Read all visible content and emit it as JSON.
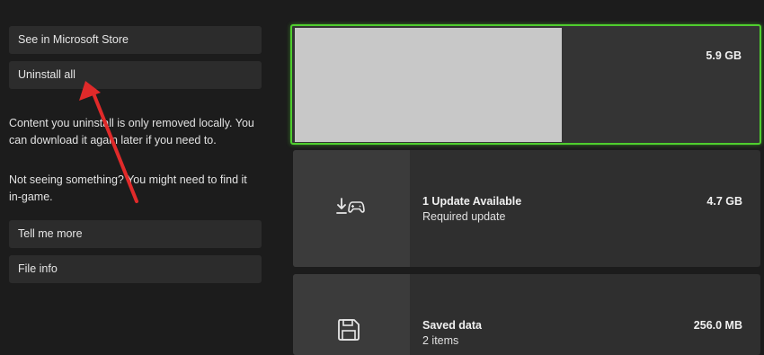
{
  "left_panel": {
    "see_store_label": "See in Microsoft Store",
    "uninstall_all_label": "Uninstall all",
    "uninstall_note": "Content you uninstall is only removed locally. You can download it again later if you need to.",
    "not_seeing_note": "Not seeing something? You might need to find it in-game.",
    "tell_more_label": "Tell me more",
    "file_info_label": "File info"
  },
  "cards": [
    {
      "size": "5.9 GB"
    },
    {
      "icon": "download-controller-icon",
      "title": "1 Update Available",
      "subtitle": "Required update",
      "size": "4.7 GB"
    },
    {
      "icon": "save-disk-icon",
      "title": "Saved data",
      "subtitle": "2 items",
      "size": "256.0 MB"
    }
  ],
  "colors": {
    "background": "#1c1c1c",
    "focus_border": "#4fce2e",
    "annotation_arrow": "#e02a2a"
  }
}
